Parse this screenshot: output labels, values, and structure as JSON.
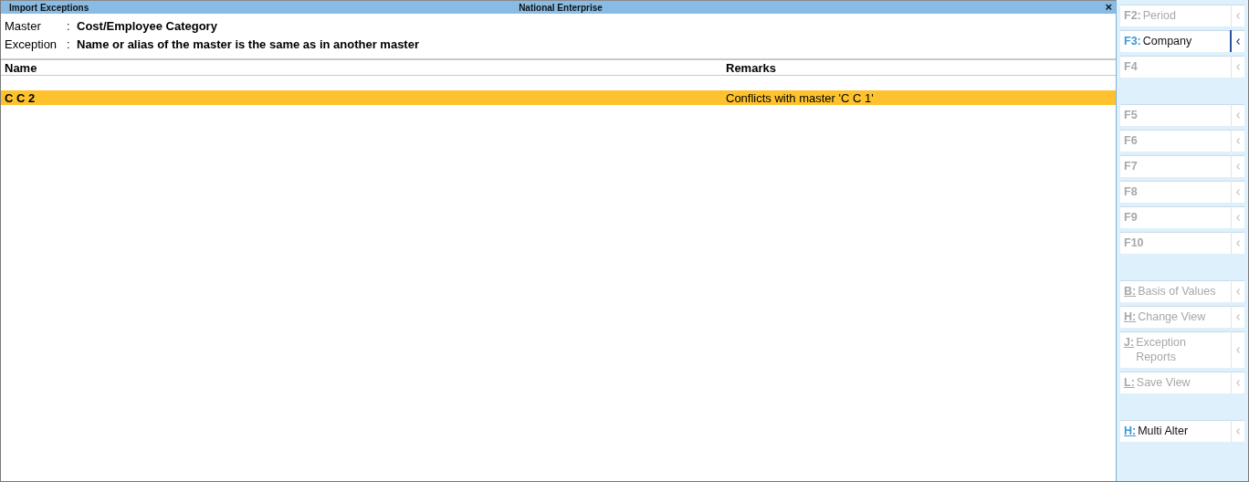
{
  "window": {
    "title": "Import Exceptions",
    "company": "National Enterprise",
    "close": "×"
  },
  "info": [
    {
      "label": "Master",
      "sep": ":",
      "value": "Cost/Employee Category"
    },
    {
      "label": "Exception",
      "sep": ":",
      "value": "Name or alias of the master is the same as in another master"
    }
  ],
  "table": {
    "columns": [
      "Name",
      "Remarks"
    ],
    "rows": [
      {
        "cells": [
          "C C 2",
          "Conflicts with master 'C C 1'"
        ],
        "selected": true
      }
    ]
  },
  "sidebar": {
    "groups": [
      [
        {
          "kind": "function",
          "key": "F2:",
          "label": "Period",
          "disabled": true,
          "selected": false
        },
        {
          "kind": "function",
          "key": "F3:",
          "label": "Company",
          "disabled": false,
          "selected": true
        },
        {
          "kind": "function",
          "key": "F4",
          "disabled": true,
          "selected": false
        }
      ],
      [
        {
          "kind": "function",
          "key": "F5",
          "disabled": true,
          "selected": false
        },
        {
          "kind": "function",
          "key": "F6",
          "disabled": true,
          "selected": false
        },
        {
          "kind": "function",
          "key": "F7",
          "disabled": true,
          "selected": false
        },
        {
          "kind": "function",
          "key": "F8",
          "disabled": true,
          "selected": false
        },
        {
          "kind": "function",
          "key": "F9",
          "disabled": true,
          "selected": false
        },
        {
          "kind": "function",
          "key": "F10",
          "disabled": true,
          "selected": false
        }
      ],
      [
        {
          "kind": "letter",
          "key": "B:",
          "label": "Basis of Values",
          "disabled": true,
          "selected": false
        },
        {
          "kind": "letter",
          "key": "H:",
          "label": "Change View",
          "disabled": true,
          "selected": false
        },
        {
          "kind": "letter",
          "key": "J:",
          "label": "Exception Reports",
          "disabled": true,
          "selected": false
        },
        {
          "kind": "letter",
          "key": "L:",
          "label": "Save View",
          "disabled": true,
          "selected": false
        }
      ],
      [
        {
          "kind": "letter",
          "key": "H:",
          "label": "Multi Alter",
          "disabled": false,
          "selected": false
        }
      ]
    ]
  }
}
